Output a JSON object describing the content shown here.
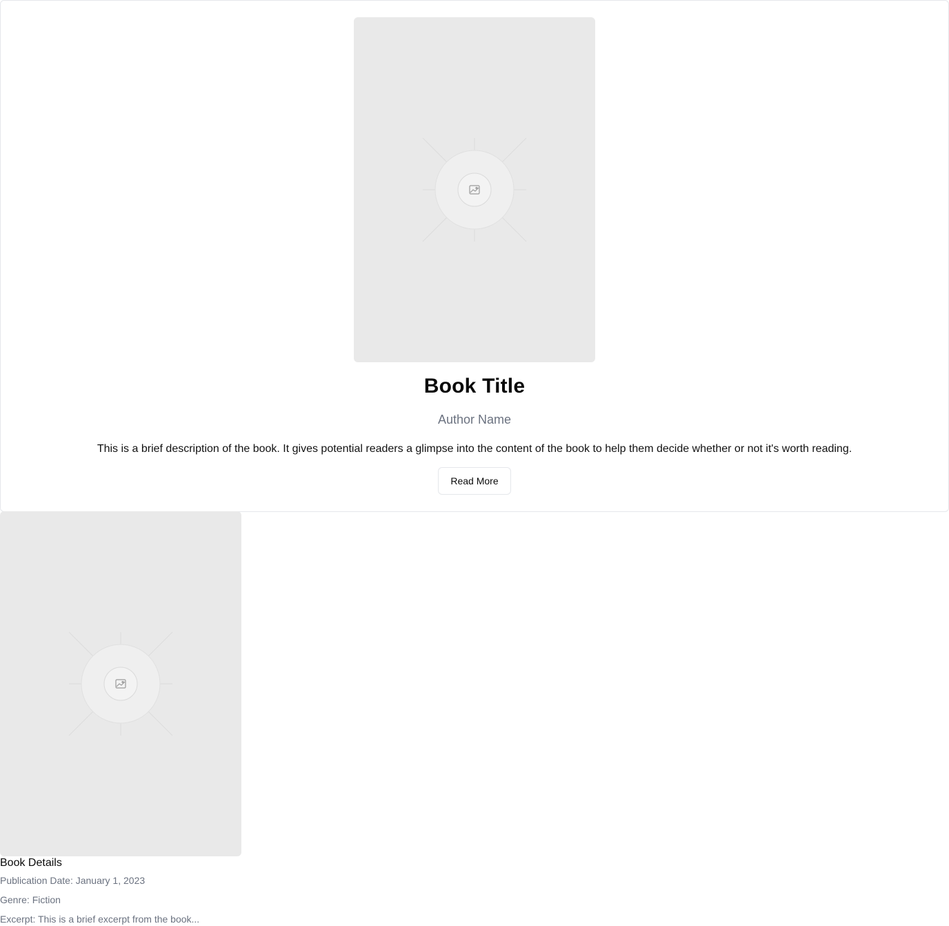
{
  "book": {
    "title": "Book Title",
    "author": "Author Name",
    "description": "This is a brief description of the book. It gives potential readers a glimpse into the content of the book to help them decide whether or not it's worth reading.",
    "read_more_label": "Read More",
    "cover_icon": "image-placeholder-icon"
  },
  "details": {
    "heading": "Book Details",
    "publication_date": "Publication Date: January 1, 2023",
    "genre": "Genre: Fiction",
    "excerpt": "Excerpt: This is a brief excerpt from the book..."
  },
  "colors": {
    "placeholder_bg": "#e9e9e9",
    "muted_text": "#6b7280",
    "border": "#e5e7eb"
  }
}
